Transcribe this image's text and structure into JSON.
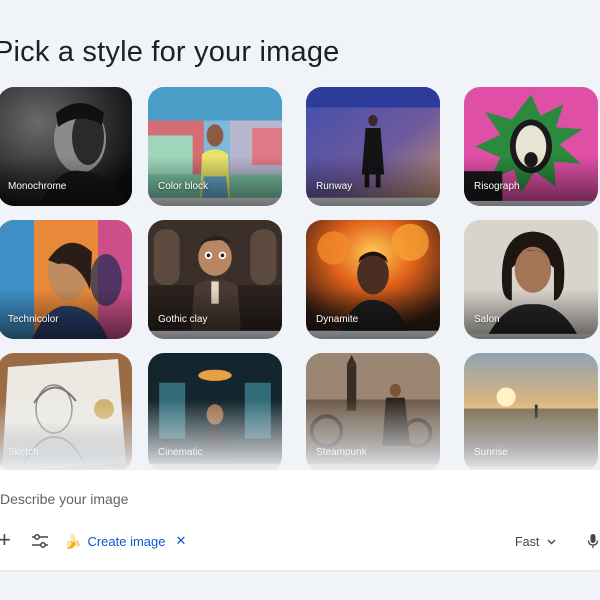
{
  "heading": "Pick a style for your image",
  "styles": [
    {
      "label": "Monochrome"
    },
    {
      "label": "Color block"
    },
    {
      "label": "Runway"
    },
    {
      "label": "Risograph"
    },
    {
      "label": "Technicolor"
    },
    {
      "label": "Gothic clay"
    },
    {
      "label": "Dynamite"
    },
    {
      "label": "Salon"
    },
    {
      "label": "Sketch"
    },
    {
      "label": "Cinematic"
    },
    {
      "label": "Steampunk"
    },
    {
      "label": "Sunrise"
    }
  ],
  "prompt": {
    "placeholder": "Describe your image",
    "plus_icon": "plus-icon",
    "tools_icon": "tune-icon",
    "chip_icon": "banana-icon",
    "chip_label": "Create image",
    "chip_close_icon": "close-icon",
    "mode_label": "Fast",
    "mode_icon": "chevron-down-icon",
    "mic_icon": "microphone-icon"
  },
  "colors": {
    "page_background": "#f0f4f9",
    "accent": "#0b57d0"
  }
}
